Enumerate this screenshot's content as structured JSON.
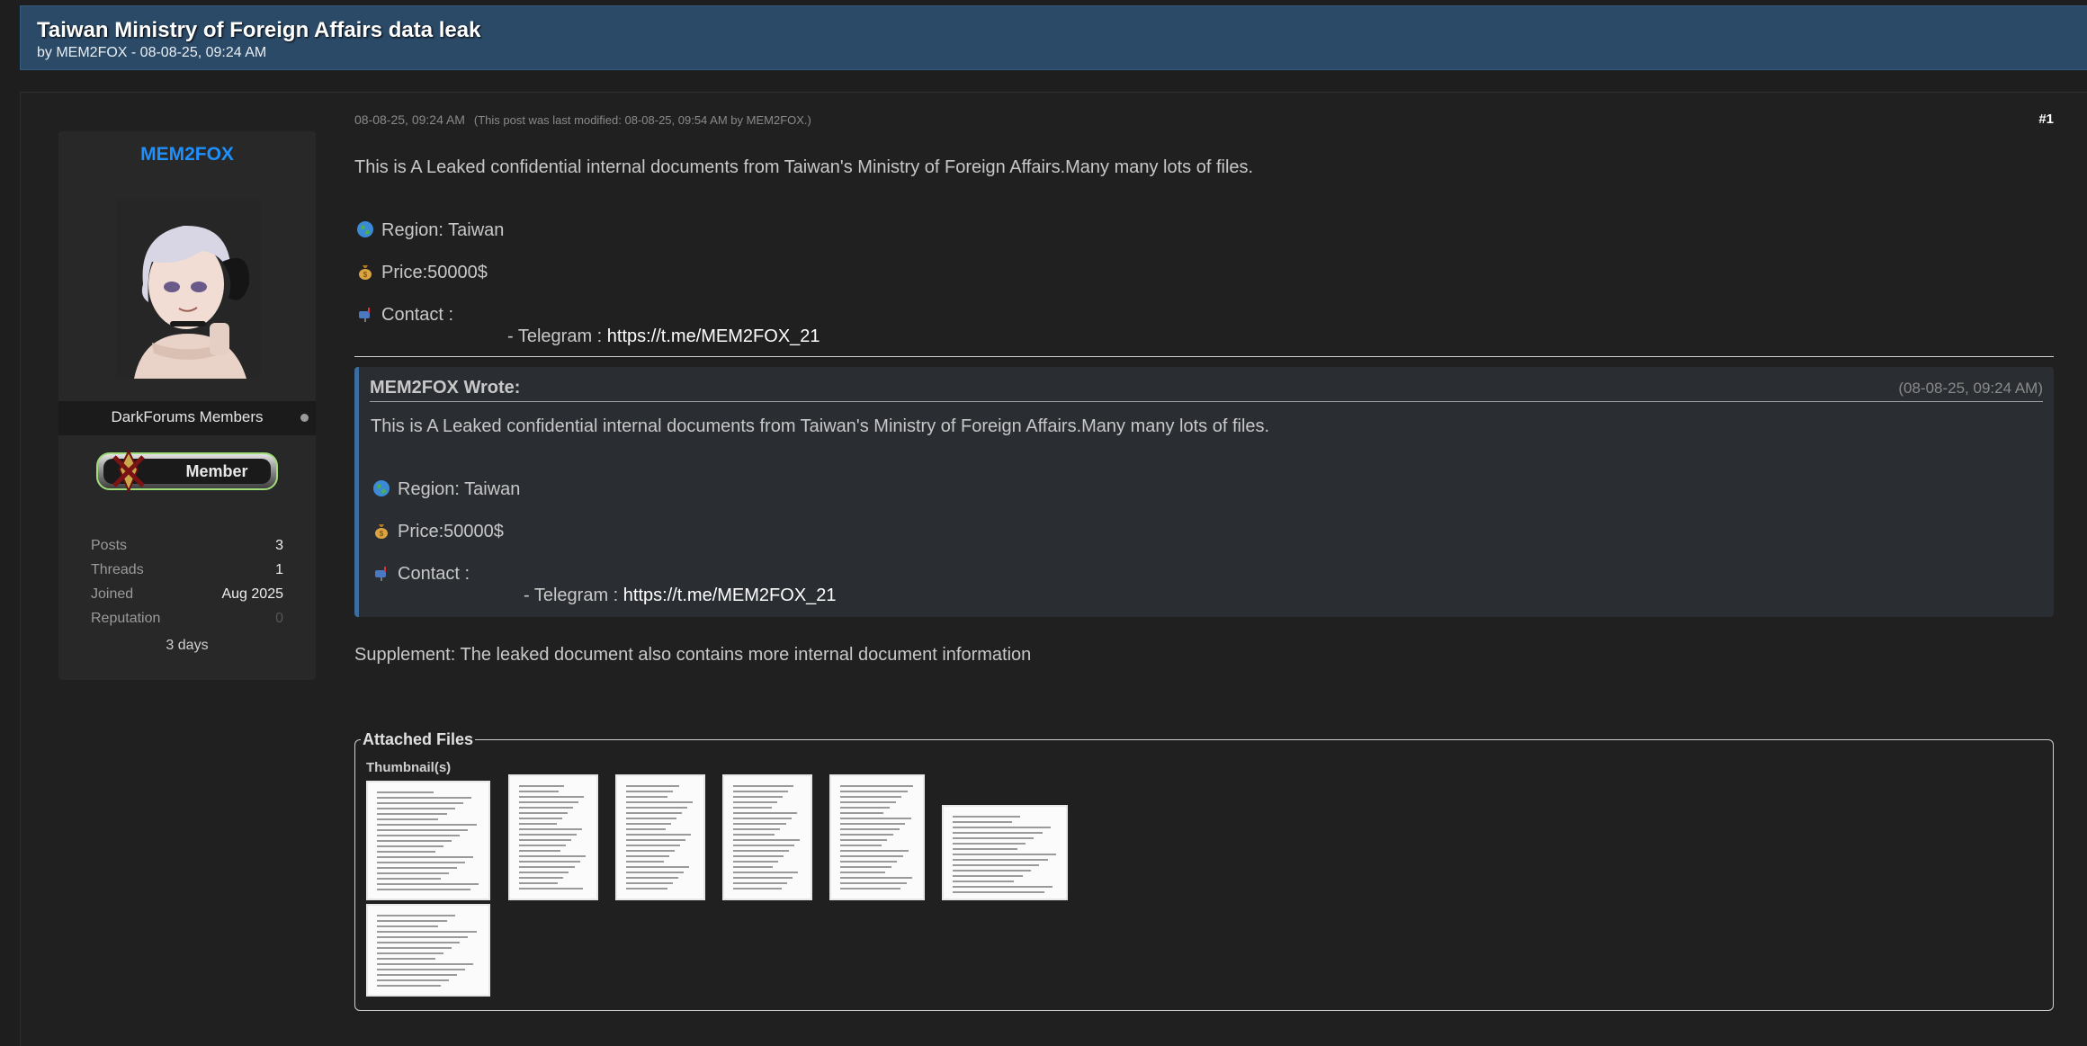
{
  "thread": {
    "title": "Taiwan Ministry of Foreign Affairs data leak",
    "byline": "by MEM2FOX - 08-08-25, 09:24 AM"
  },
  "author": {
    "name": "MEM2FOX",
    "group": "DarkForums Members",
    "badge_label": "Member",
    "stats": [
      {
        "label": "Posts",
        "value": "3"
      },
      {
        "label": "Threads",
        "value": "1"
      },
      {
        "label": "Joined",
        "value": "Aug 2025"
      },
      {
        "label": "Reputation",
        "value": "0"
      }
    ],
    "since": "3 days"
  },
  "post": {
    "date": "08-08-25, 09:24 AM",
    "modified": "(This post was last modified: 08-08-25, 09:54 AM by MEM2FOX.)",
    "number": "#1",
    "intro": "This is A Leaked confidential internal documents from Taiwan's Ministry of Foreign Affairs.Many many lots of files.",
    "region": "Region:  Taiwan",
    "price": "Price:50000$",
    "contact": "Contact :",
    "telegram_prefix": "- Telegram : ",
    "telegram_link": "https://t.me/MEM2FOX_21",
    "supplement": "Supplement: The leaked document also contains more internal document information"
  },
  "quote": {
    "header": "MEM2FOX Wrote:",
    "date": "(08-08-25, 09:24 AM)",
    "intro": "This is A Leaked confidential internal documents from Taiwan's Ministry of Foreign Affairs.Many many lots of files.",
    "region": "Region:  Taiwan",
    "price": "Price:50000$",
    "contact": "Contact :",
    "telegram_prefix": "- Telegram : ",
    "telegram_link": "https://t.me/MEM2FOX_21"
  },
  "attachments": {
    "legend": "Attached Files",
    "thumbs_label": "Thumbnail(s)",
    "thumbnail_count": 7
  },
  "icons": [
    "globe-icon",
    "money-bag-icon",
    "mailbox-icon"
  ],
  "colors": {
    "accent": "#1e90ff",
    "title_bar": "#2b4a68",
    "quote_border": "#3b6e9e"
  }
}
